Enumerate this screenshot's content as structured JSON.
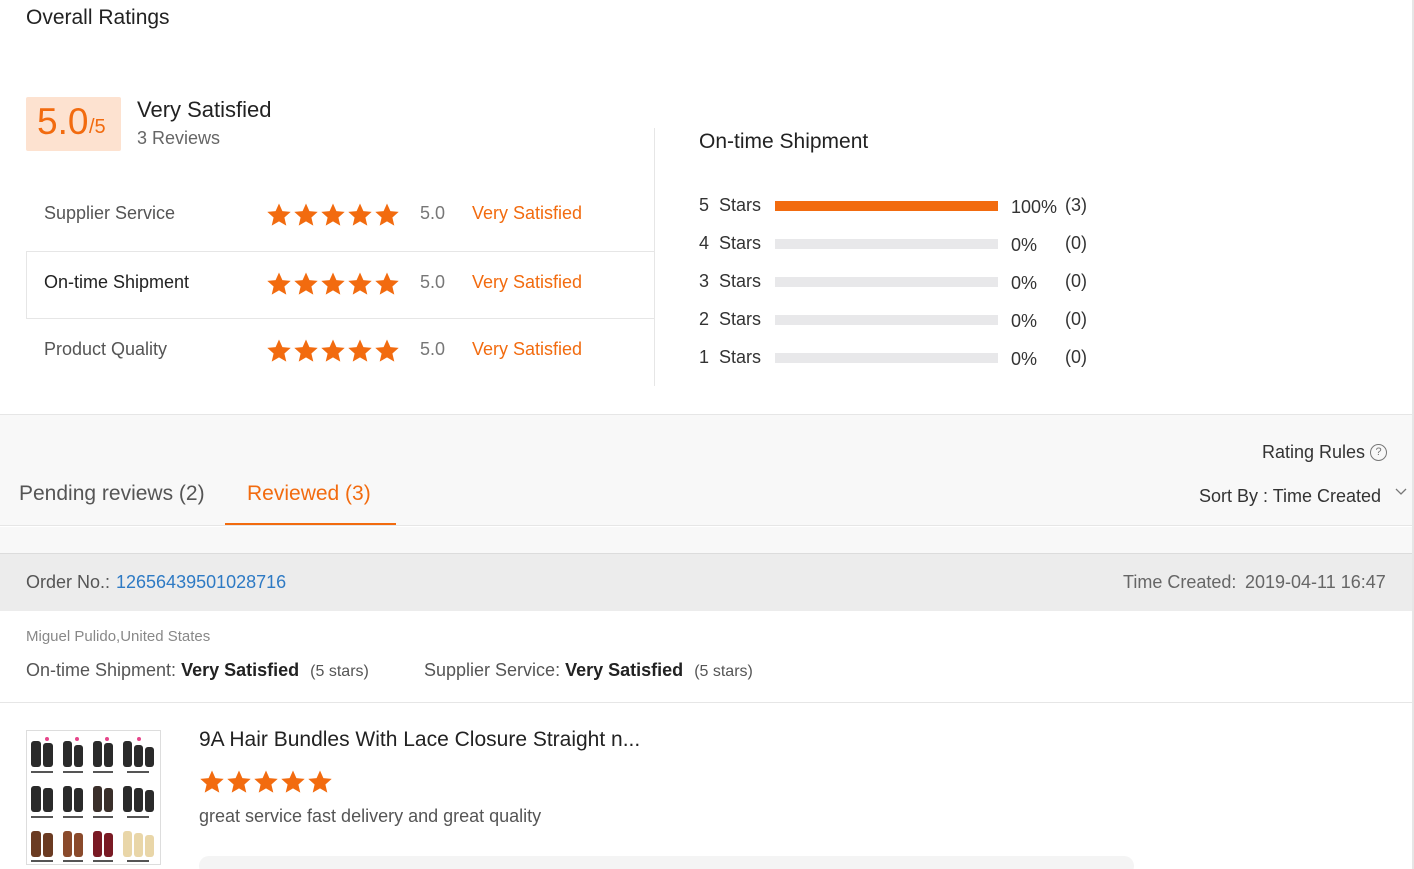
{
  "header": {
    "title": "Overall Ratings"
  },
  "summary": {
    "score": "5.0",
    "out_of": "/5",
    "label": "Very Satisfied",
    "count": "3 Reviews"
  },
  "categories": [
    {
      "name": "Supplier Service",
      "score": "5.0",
      "label": "Very Satisfied",
      "stars": 5
    },
    {
      "name": "On-time Shipment",
      "score": "5.0",
      "label": "Very Satisfied",
      "stars": 5
    },
    {
      "name": "Product Quality",
      "score": "5.0",
      "label": "Very Satisfied",
      "stars": 5
    }
  ],
  "distribution": {
    "title": "On-time Shipment",
    "rows": [
      {
        "label": "5  Stars",
        "percent": "100%",
        "count": "(3)",
        "fraction": 1.0
      },
      {
        "label": "4  Stars",
        "percent": "0%",
        "count": "(0)",
        "fraction": 0
      },
      {
        "label": "3  Stars",
        "percent": "0%",
        "count": "(0)",
        "fraction": 0
      },
      {
        "label": "2  Stars",
        "percent": "0%",
        "count": "(0)",
        "fraction": 0
      },
      {
        "label": "1  Stars",
        "percent": "0%",
        "count": "(0)",
        "fraction": 0
      }
    ]
  },
  "tabs": {
    "pending": "Pending reviews (2)",
    "reviewed": "Reviewed (3)",
    "rating_rules": "Rating Rules",
    "sort_by": "Sort By : Time Created"
  },
  "order": {
    "label": "Order No.:",
    "number": "12656439501028716",
    "time_label": "Time Created:",
    "time": "2019-04-11 16:47",
    "buyer": "Miguel Pulido,United States",
    "shipment_key": "On-time Shipment:",
    "shipment_value": "Very Satisfied",
    "shipment_stars": "(5 stars)",
    "service_key": "Supplier Service:",
    "service_value": "Very Satisfied",
    "service_stars": "(5 stars)"
  },
  "product": {
    "title": "9A Hair Bundles With Lace Closure Straight n...",
    "stars": 5,
    "review": "great service fast delivery and great quality"
  },
  "colors": {
    "accent": "#f26b0f",
    "link": "#2e7ac4",
    "score_bg": "#fde2d0"
  }
}
